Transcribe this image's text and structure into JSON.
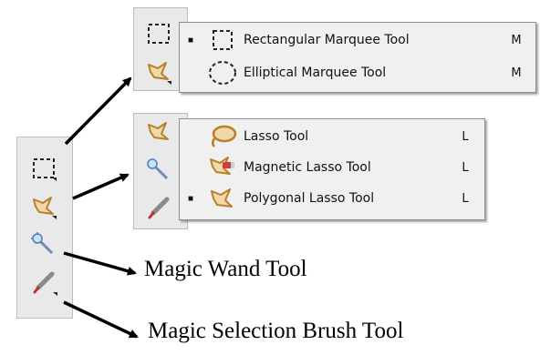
{
  "toolbar": {
    "tools": [
      {
        "name": "marquee-tool",
        "icon": "rectangular-marquee-icon"
      },
      {
        "name": "lasso-tool",
        "icon": "polygonal-lasso-icon"
      },
      {
        "name": "magic-wand-tool",
        "icon": "magic-wand-icon"
      },
      {
        "name": "selection-brush-tool",
        "icon": "selection-brush-icon"
      }
    ]
  },
  "marquee_flyout": {
    "items": [
      {
        "label": "Rectangular Marquee Tool",
        "shortcut": "M",
        "selected": "■",
        "icon": "rectangular-marquee-icon"
      },
      {
        "label": "Elliptical Marquee Tool",
        "shortcut": "M",
        "selected": "",
        "icon": "elliptical-marquee-icon"
      }
    ]
  },
  "lasso_flyout": {
    "items": [
      {
        "label": "Lasso Tool",
        "shortcut": "L",
        "selected": "",
        "icon": "lasso-icon"
      },
      {
        "label": "Magnetic Lasso Tool",
        "shortcut": "L",
        "selected": "",
        "icon": "magnetic-lasso-icon"
      },
      {
        "label": "Polygonal Lasso Tool",
        "shortcut": "L",
        "selected": "■",
        "icon": "polygonal-lasso-icon"
      }
    ]
  },
  "captions": {
    "magic_wand": "Magic Wand Tool",
    "selection_brush": "Magic Selection Brush Tool"
  },
  "colors": {
    "lasso_gold": "#b8802c",
    "panel_bg": "#e9e9e9",
    "flyout_bg": "#f0f0f0",
    "wand_blue": "#4a7fc1",
    "brush_red": "#c03030"
  }
}
